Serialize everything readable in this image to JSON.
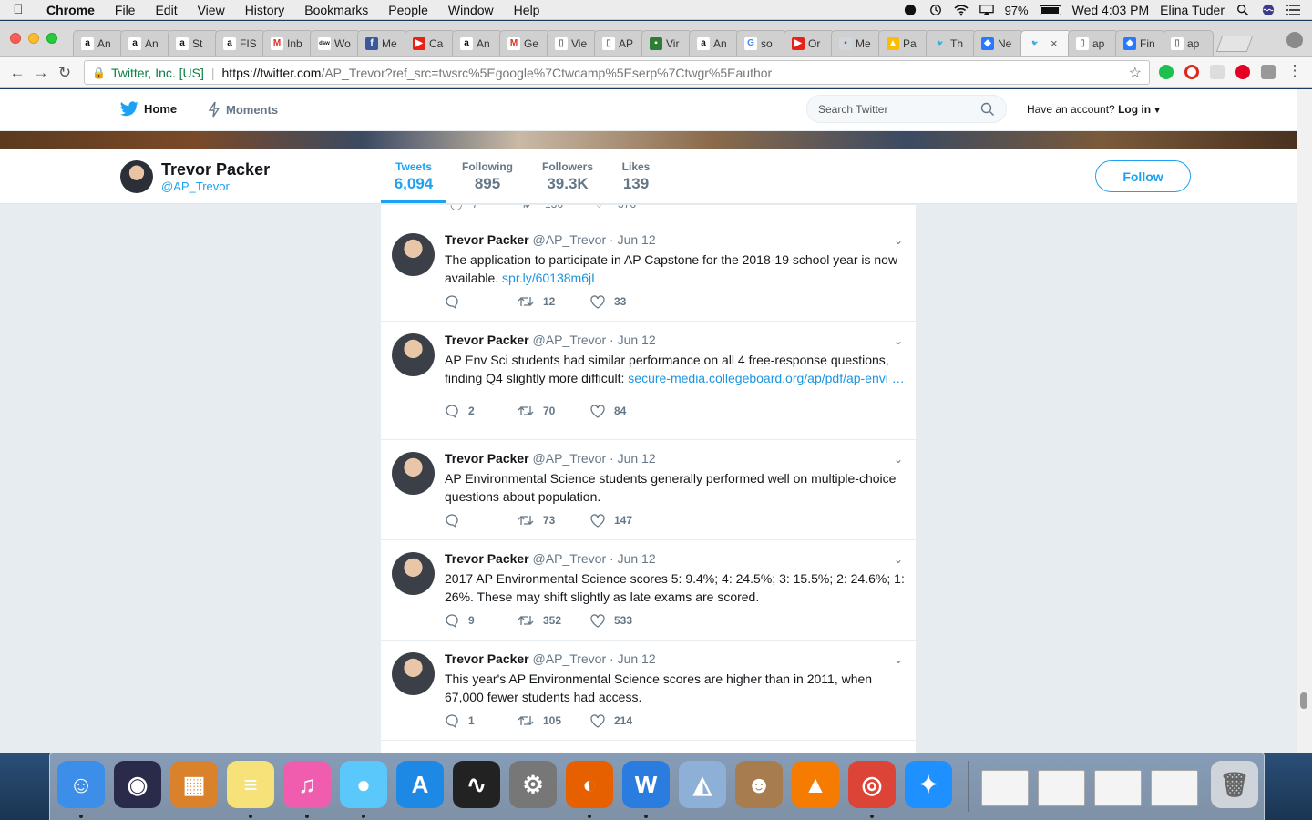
{
  "menubar": {
    "app": "Chrome",
    "items": [
      "File",
      "Edit",
      "View",
      "History",
      "Bookmarks",
      "People",
      "Window",
      "Help"
    ],
    "battery": "97%",
    "clock": "Wed 4:03 PM",
    "user": "Elina Tuder"
  },
  "tabs": [
    {
      "label": "An",
      "icon": "amazon-icon"
    },
    {
      "label": "An",
      "icon": "amazon-icon"
    },
    {
      "label": "St",
      "icon": "amazon-icon"
    },
    {
      "label": "FIS",
      "icon": "amazon-icon"
    },
    {
      "label": "Inb",
      "icon": "gmail-icon"
    },
    {
      "label": "Wo",
      "icon": "dsw-icon"
    },
    {
      "label": "Me",
      "icon": "facebook-icon"
    },
    {
      "label": "Ca",
      "icon": "youtube-icon"
    },
    {
      "label": "An",
      "icon": "amazon-icon"
    },
    {
      "label": "Ge",
      "icon": "gmail-icon"
    },
    {
      "label": "Vie",
      "icon": "document-icon"
    },
    {
      "label": "AP",
      "icon": "document-icon"
    },
    {
      "label": "Vir",
      "icon": "flag-icon"
    },
    {
      "label": "An",
      "icon": "amazon-icon"
    },
    {
      "label": "so",
      "icon": "google-icon"
    },
    {
      "label": "Or",
      "icon": "youtube-icon"
    },
    {
      "label": "Me",
      "icon": "image-icon"
    },
    {
      "label": "Pa",
      "icon": "google-drive-icon"
    },
    {
      "label": "Th",
      "icon": "twitter-icon"
    },
    {
      "label": "Ne",
      "icon": "shield-icon"
    },
    {
      "label": "",
      "icon": "twitter-icon",
      "active": true
    },
    {
      "label": "ap",
      "icon": "document-icon"
    },
    {
      "label": "Fin",
      "icon": "shield-icon"
    },
    {
      "label": "ap",
      "icon": "document-icon"
    }
  ],
  "address_bar": {
    "secure_label": "Twitter, Inc. [US]",
    "url_scheme_host": "https://twitter.com",
    "url_path": "/AP_Trevor?ref_src=twsrc%5Egoogle%7Ctwcamp%5Eserp%7Ctwgr%5Eauthor"
  },
  "twitter_nav": {
    "home": "Home",
    "moments": "Moments",
    "search_placeholder": "Search Twitter",
    "have_account": "Have an account?",
    "login": "Log in"
  },
  "profile": {
    "name": "Trevor Packer",
    "handle": "@AP_Trevor",
    "stats": [
      {
        "label": "Tweets",
        "value": "6,094",
        "active": true
      },
      {
        "label": "Following",
        "value": "895"
      },
      {
        "label": "Followers",
        "value": "39.3K"
      },
      {
        "label": "Likes",
        "value": "139"
      }
    ],
    "follow_label": "Follow"
  },
  "previous_tweet_partial": {
    "replies": "7",
    "retweets": "136",
    "likes": "376"
  },
  "tweets": [
    {
      "name": "Trevor Packer",
      "handle": "@AP_Trevor",
      "date": "· Jun 12",
      "text": "The application to participate in AP Capstone for the 2018-19 school year is now available. ",
      "link": "spr.ly/60138m6jL",
      "replies": "",
      "retweets": "12",
      "likes": "33"
    },
    {
      "name": "Trevor Packer",
      "handle": "@AP_Trevor",
      "date": "· Jun 12",
      "text": "AP Env Sci students had similar performance on all 4 free-response questions, finding Q4 slightly more difficult: ",
      "link": "secure-media.collegeboard.org/ap/pdf/ap-envi …",
      "replies": "2",
      "retweets": "70",
      "likes": "84"
    },
    {
      "name": "Trevor Packer",
      "handle": "@AP_Trevor",
      "date": "· Jun 12",
      "text": "AP Environmental Science students generally performed well on multiple-choice questions about population.",
      "link": "",
      "replies": "",
      "retweets": "73",
      "likes": "147"
    },
    {
      "name": "Trevor Packer",
      "handle": "@AP_Trevor",
      "date": "· Jun 12",
      "text": "2017 AP Environmental Science scores   5: 9.4%; 4: 24.5%; 3: 15.5%; 2: 24.6%; 1: 26%. These may shift slightly as late exams are scored.",
      "link": "",
      "replies": "9",
      "retweets": "352",
      "likes": "533"
    },
    {
      "name": "Trevor Packer",
      "handle": "@AP_Trevor",
      "date": "· Jun 12",
      "text": "This year's AP Environmental Science scores are higher than in 2011, when 67,000 fewer students had access.",
      "link": "",
      "replies": "1",
      "retweets": "105",
      "likes": "214"
    }
  ],
  "dock": {
    "apps": [
      {
        "name": "finder-icon",
        "color": "#3d8ee8",
        "running": true
      },
      {
        "name": "siri-icon",
        "color": "#2a2a4a",
        "running": false
      },
      {
        "name": "calculator-icon",
        "color": "#d9822b",
        "running": false
      },
      {
        "name": "notes-icon",
        "color": "#f7e27a",
        "running": true
      },
      {
        "name": "itunes-icon",
        "color": "#f15dae",
        "running": true
      },
      {
        "name": "messages-icon",
        "color": "#5ac8fa",
        "running": true
      },
      {
        "name": "app-store-icon",
        "color": "#1e88e5",
        "running": false
      },
      {
        "name": "activity-monitor-icon",
        "color": "#222",
        "running": false
      },
      {
        "name": "system-preferences-icon",
        "color": "#777",
        "running": false
      },
      {
        "name": "firefox-icon",
        "color": "#e66000",
        "running": true
      },
      {
        "name": "word-icon",
        "color": "#2a7ddf",
        "running": true
      },
      {
        "name": "preview-icon",
        "color": "#8fb0d6",
        "running": false
      },
      {
        "name": "contacts-icon",
        "color": "#a77c4e",
        "running": false
      },
      {
        "name": "vlc-icon",
        "color": "#f57c00",
        "running": false
      },
      {
        "name": "chrome-icon",
        "color": "#db4437",
        "running": true
      },
      {
        "name": "safari-icon",
        "color": "#1e90ff",
        "running": false
      }
    ],
    "minimized": [
      {
        "name": "minimized-word-window-1"
      },
      {
        "name": "minimized-word-window-2"
      },
      {
        "name": "minimized-word-window-3"
      },
      {
        "name": "minimized-word-window-4"
      }
    ]
  }
}
